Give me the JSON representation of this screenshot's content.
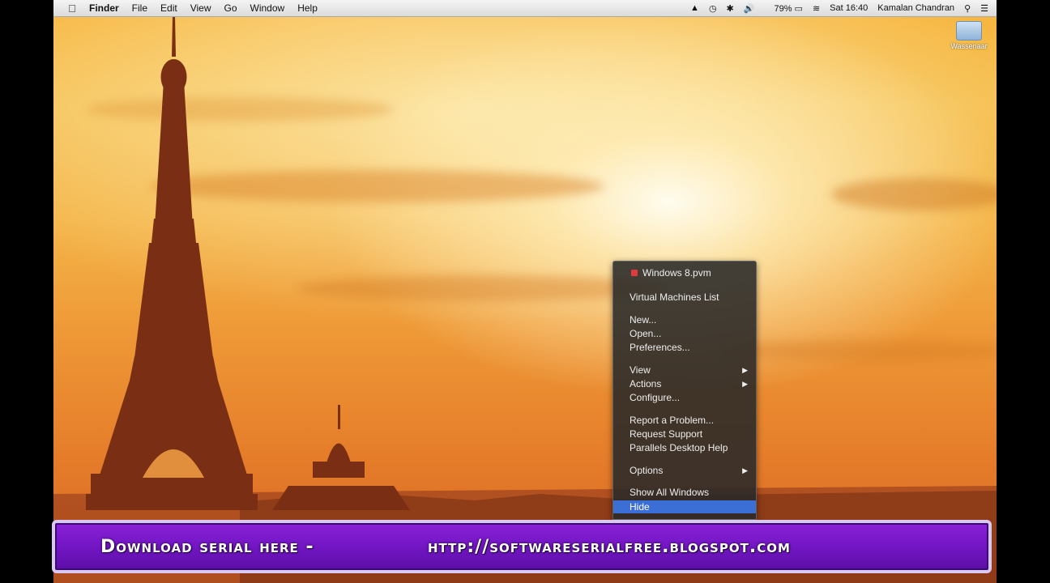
{
  "menubar": {
    "apple_icon": "apple-logo-icon",
    "items": [
      "Finder",
      "File",
      "Edit",
      "View",
      "Go",
      "Window",
      "Help"
    ],
    "status": {
      "battery_text": "79%",
      "clock": "Sat 16:40",
      "user": "Kamalan Chandran"
    }
  },
  "desktop": {
    "volume_label": "Wassenaar"
  },
  "dock_menu": {
    "title": "Windows 8.pvm",
    "items": [
      {
        "label": "Virtual Machines List"
      },
      {
        "label": "New..."
      },
      {
        "label": "Open..."
      },
      {
        "label": "Preferences..."
      },
      {
        "label": "View",
        "submenu": true
      },
      {
        "label": "Actions",
        "submenu": true
      },
      {
        "label": "Configure..."
      },
      {
        "label": "Report a Problem..."
      },
      {
        "label": "Request Support"
      },
      {
        "label": "Parallels Desktop Help"
      },
      {
        "label": "Options",
        "submenu": true
      },
      {
        "label": "Show All Windows"
      },
      {
        "label": "Hide",
        "active": true
      }
    ]
  },
  "banner": {
    "left_text": "Download serial here -",
    "right_text": "http://softwareserialfree.blogspot.com",
    "color": "#7a1ccc"
  }
}
